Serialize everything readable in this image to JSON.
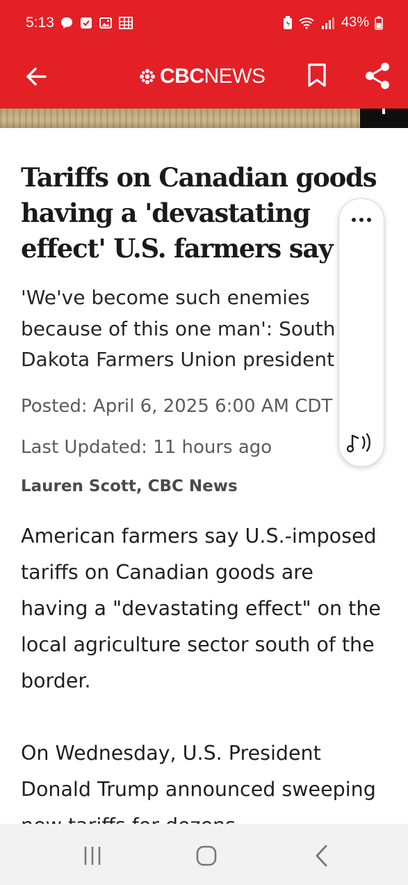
{
  "status_bar": {
    "time": "5:13",
    "battery": "43%",
    "icons": [
      "chat-bubble-icon",
      "checkbox-icon",
      "image-icon",
      "grid-icon",
      "battery-saver-icon",
      "wifi-icon",
      "signal-icon",
      "battery-icon"
    ]
  },
  "app_bar": {
    "brand_bold": "CBC",
    "brand_light": "NEWS",
    "background": "#e32026"
  },
  "article": {
    "headline": "Tariffs on Canadian goods having a 'devastating effect' U.S. farmers say",
    "deck": "'We've become such enemies because of this one man': South Dakota Farmers Union president",
    "posted": "Posted: April 6, 2025 6:00 AM CDT",
    "updated": "Last Updated: 11 hours ago",
    "byline": "Lauren Scott, CBC News",
    "paragraphs": [
      "American farmers say U.S.-imposed tariffs on Canadian goods are having a \"devastating effect\" on the local agriculture sector south of the border.",
      "On Wednesday, U.S. President Donald Trump announced sweeping new tariffs for dozens"
    ]
  },
  "tts": {
    "more_icon": "more-horizontal-icon",
    "play_icon": "audio-note-icon"
  },
  "navigation": {
    "icons": [
      "recents-icon",
      "home-icon",
      "back-chevron-icon"
    ]
  }
}
